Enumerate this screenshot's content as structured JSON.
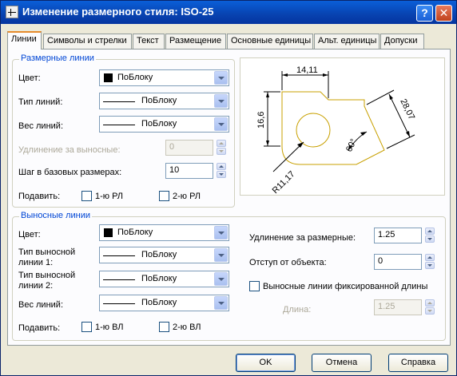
{
  "window": {
    "title": "Изменение размерного стиля: ISO-25",
    "help": "?",
    "close": "✕"
  },
  "tabs": [
    "Линии",
    "Символы и стрелки",
    "Текст",
    "Размещение",
    "Основные единицы",
    "Альт. единицы",
    "Допуски"
  ],
  "dim_lines": {
    "group_title": "Размерные линии",
    "color_label": "Цвет:",
    "color_value": "ПоБлоку",
    "linetype_label": "Тип линий:",
    "linetype_value": "ПоБлоку",
    "lineweight_label": "Вес линий:",
    "lineweight_value": "ПоБлоку",
    "extend_label": "Удлинение за выносные:",
    "extend_value": "0",
    "baseline_label": "Шаг в базовых размерах:",
    "baseline_value": "10",
    "suppress_label": "Подавить:",
    "suppress_1": "1-ю РЛ",
    "suppress_2": "2-ю РЛ"
  },
  "ext_lines": {
    "group_title": "Выносные линии",
    "color_label": "Цвет:",
    "color_value": "ПоБлоку",
    "linetype1_label_1": "Тип выносной",
    "linetype1_label_2": "линии 1:",
    "linetype1_value": "ПоБлоку",
    "linetype2_label_1": "Тип выносной",
    "linetype2_label_2": "линии 2:",
    "linetype2_value": "ПоБлоку",
    "lineweight_label": "Вес линий:",
    "lineweight_value": "ПоБлоку",
    "suppress_label": "Подавить:",
    "suppress_1": "1-ю ВЛ",
    "suppress_2": "2-ю ВЛ",
    "extend_label": "Удлинение за размерные:",
    "extend_value": "1.25",
    "offset_label": "Отступ от объекта:",
    "offset_value": "0",
    "fixed_label": "Выносные линии фиксированной длины",
    "length_label": "Длина:",
    "length_value": "1.25"
  },
  "preview": {
    "dim_top": "14,11",
    "dim_left": "16,6",
    "dim_diag": "28,07",
    "dim_angle": "60°",
    "dim_radius": "R11,17"
  },
  "buttons": {
    "ok": "OK",
    "cancel": "Отмена",
    "help": "Справка"
  },
  "colors": {
    "accent": "#0046d5",
    "title_bar": "#0842b0",
    "preview_line": "#c8a000"
  }
}
